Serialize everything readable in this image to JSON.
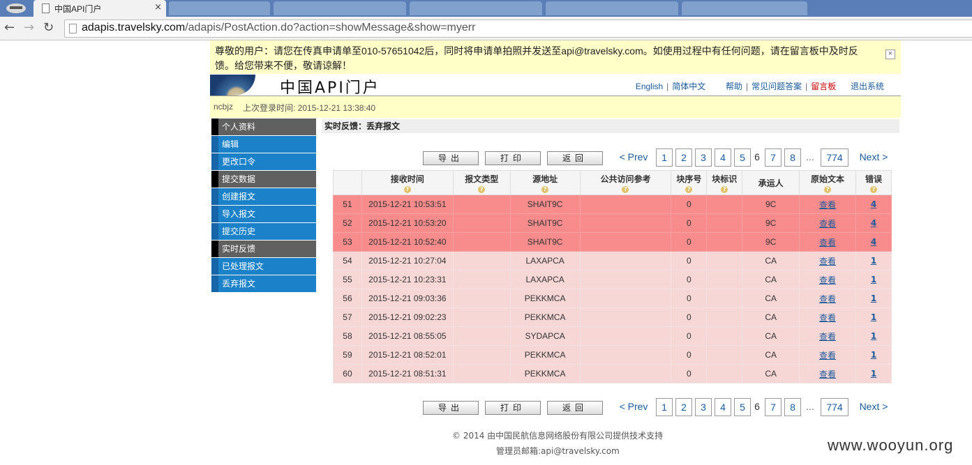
{
  "browser": {
    "tab_title": "中国API门户",
    "tab_close": "×",
    "url_host": "adapis.travelsky.com",
    "url_path": "/adapis/PostAction.do?action=showMessage&show=myerr"
  },
  "notice": {
    "text": "尊敬的用户：请您在传真申请单至010-57651042后，同时将申请单拍照并发送至api@travelsky.com。如使用过程中有任何问题，请在留言板中及时反馈。给您带来不便，敬请谅解！",
    "close": "×"
  },
  "header": {
    "site_title": "中国API门户",
    "nav": {
      "english": "English",
      "simplified_chinese": "简体中文",
      "help": "帮助",
      "faq": "常见问题答案",
      "message_board": "留言板",
      "logout": "退出系统",
      "sep": "|"
    }
  },
  "userbar": {
    "username": "ncbjz",
    "last_login": "上次登录时间: 2015-12-21 13:38:40"
  },
  "sidebar": {
    "items": [
      {
        "label": "个人资料",
        "kind": "group"
      },
      {
        "label": "编辑",
        "kind": "link"
      },
      {
        "label": "更改口令",
        "kind": "link"
      },
      {
        "label": "提交数据",
        "kind": "group"
      },
      {
        "label": "创建报文",
        "kind": "link"
      },
      {
        "label": "导入报文",
        "kind": "link"
      },
      {
        "label": "提交历史",
        "kind": "link"
      },
      {
        "label": "实时反馈",
        "kind": "group"
      },
      {
        "label": "已处理报文",
        "kind": "link"
      },
      {
        "label": "丢弃报文",
        "kind": "link"
      }
    ]
  },
  "main": {
    "section_title": "实时反馈：丢弃报文",
    "actions": {
      "export": "导出",
      "print": "打印",
      "back": "返回"
    },
    "pager": {
      "prev": "< Prev",
      "pages": [
        "1",
        "2",
        "3",
        "4",
        "5"
      ],
      "current": "6",
      "after": [
        "7",
        "8"
      ],
      "dots": "...",
      "last": "774",
      "next": "Next >"
    },
    "columns": [
      "",
      "接收时间",
      "报文类型",
      "源地址",
      "公共访问参考",
      "块序号",
      "块标识",
      "承运人",
      "原始文本",
      "错误"
    ],
    "help_glyph": "?",
    "rows": [
      {
        "no": "51",
        "time": "2015-12-21 10:53:51",
        "type": "",
        "src": "SHAIT9C",
        "ref": "",
        "seq": "0",
        "blk": "",
        "carrier": "9C",
        "view": "查看",
        "err": "4",
        "state": "err"
      },
      {
        "no": "52",
        "time": "2015-12-21 10:53:20",
        "type": "",
        "src": "SHAIT9C",
        "ref": "",
        "seq": "0",
        "blk": "",
        "carrier": "9C",
        "view": "查看",
        "err": "4",
        "state": "err"
      },
      {
        "no": "53",
        "time": "2015-12-21 10:52:40",
        "type": "",
        "src": "SHAIT9C",
        "ref": "",
        "seq": "0",
        "blk": "",
        "carrier": "9C",
        "view": "查看",
        "err": "4",
        "state": "err"
      },
      {
        "no": "54",
        "time": "2015-12-21 10:27:04",
        "type": "",
        "src": "LAXAPCA",
        "ref": "",
        "seq": "0",
        "blk": "",
        "carrier": "CA",
        "view": "查看",
        "err": "1",
        "state": "ok"
      },
      {
        "no": "55",
        "time": "2015-12-21 10:23:31",
        "type": "",
        "src": "LAXAPCA",
        "ref": "",
        "seq": "0",
        "blk": "",
        "carrier": "CA",
        "view": "查看",
        "err": "1",
        "state": "ok"
      },
      {
        "no": "56",
        "time": "2015-12-21 09:03:36",
        "type": "",
        "src": "PEKKMCA",
        "ref": "",
        "seq": "0",
        "blk": "",
        "carrier": "CA",
        "view": "查看",
        "err": "1",
        "state": "ok"
      },
      {
        "no": "57",
        "time": "2015-12-21 09:02:23",
        "type": "",
        "src": "PEKKMCA",
        "ref": "",
        "seq": "0",
        "blk": "",
        "carrier": "CA",
        "view": "查看",
        "err": "1",
        "state": "ok"
      },
      {
        "no": "58",
        "time": "2015-12-21 08:55:05",
        "type": "",
        "src": "SYDAPCA",
        "ref": "",
        "seq": "0",
        "blk": "",
        "carrier": "CA",
        "view": "查看",
        "err": "1",
        "state": "ok"
      },
      {
        "no": "59",
        "time": "2015-12-21 08:52:01",
        "type": "",
        "src": "PEKKMCA",
        "ref": "",
        "seq": "0",
        "blk": "",
        "carrier": "CA",
        "view": "查看",
        "err": "1",
        "state": "ok"
      },
      {
        "no": "60",
        "time": "2015-12-21 08:51:31",
        "type": "",
        "src": "PEKKMCA",
        "ref": "",
        "seq": "0",
        "blk": "",
        "carrier": "CA",
        "view": "查看",
        "err": "1",
        "state": "ok"
      }
    ]
  },
  "footer": {
    "copyright": "© 2014 由中国民航信息网络股份有限公司提供技术支持",
    "admin_email": "管理员邮箱:api@travelsky.com"
  },
  "watermark": "www.wooyun.org",
  "colors": {
    "sidebar_group": "#606060",
    "sidebar_link": "#1b82c9",
    "row_error": "#f88c8c",
    "row_normal": "#f7d6d6",
    "notice_bg": "#ffffc8",
    "link": "#1a5a9c"
  }
}
